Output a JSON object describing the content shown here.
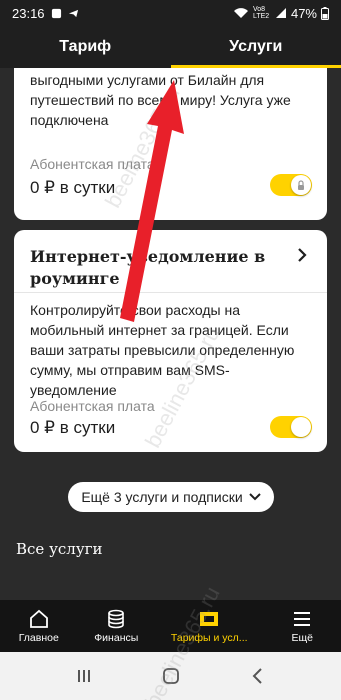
{
  "status_bar": {
    "time": "23:16",
    "network": "Vo8 LTE2",
    "battery": "47%"
  },
  "top_tabs": [
    {
      "label": "Тариф",
      "active": false
    },
    {
      "label": "Услуги",
      "active": true
    }
  ],
  "card1": {
    "text": "выгодными услугами от Билайн для путешествий по всему миру! Услуга уже подключена",
    "fee_label": "Абонентская плата",
    "fee_value": "0 ₽ в сутки",
    "toggle_on": true,
    "locked": true
  },
  "card2": {
    "title": "Интернет-уведомление в роуминге",
    "description": "Контролируйте свои расходы на мобильный интернет за границей. Если ваши затраты превысили определенную сумму, мы отправим вам SMS-уведомление",
    "fee_label": "Абонентская плата",
    "fee_value": "0 ₽ в сутки",
    "toggle_on": true
  },
  "more_button": {
    "label": "Ещё 3 услуги и подписки"
  },
  "all_services_title": "Все услуги",
  "bottom_nav": [
    {
      "label": "Главное",
      "icon": "home-icon",
      "active": false
    },
    {
      "label": "Финансы",
      "icon": "coins-icon",
      "active": false
    },
    {
      "label": "Тарифы и усл...",
      "icon": "sim-card-icon",
      "active": true
    },
    {
      "label": "Ещё",
      "icon": "menu-icon",
      "active": false
    }
  ],
  "watermark": "beeline365.ru",
  "colors": {
    "accent": "#ffd200",
    "background": "#2b2b2b",
    "card": "#ffffff",
    "arrow": "#e8202a"
  }
}
